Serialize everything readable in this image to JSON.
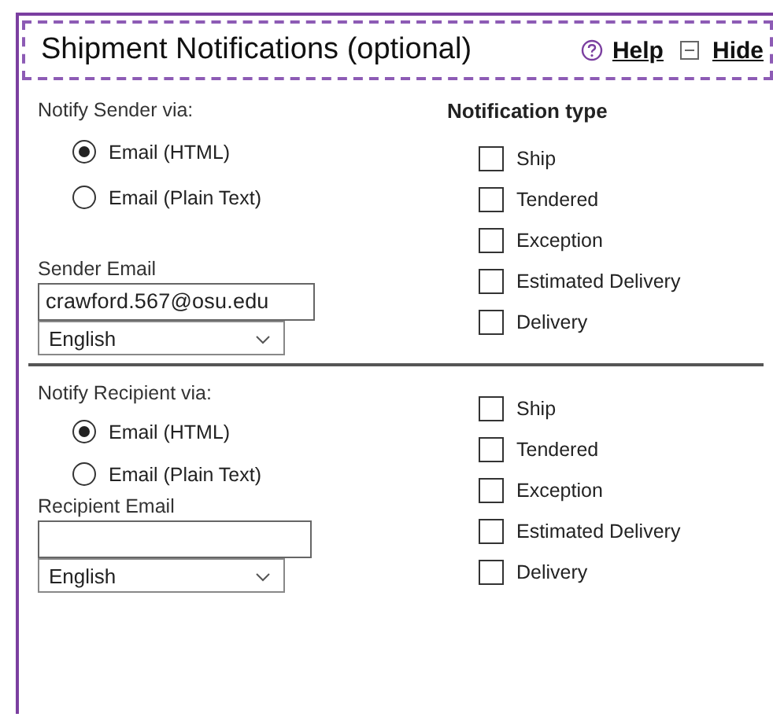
{
  "panel": {
    "title": "Shipment Notifications (optional)",
    "help_link": "Help",
    "hide_link": "Hide"
  },
  "sections": [
    {
      "via_label": "Notify Sender via:",
      "options": [
        {
          "label": "Email (HTML)",
          "selected": true
        },
        {
          "label": "Email (Plain Text)",
          "selected": false
        }
      ],
      "types_heading": "Notification type",
      "types": [
        {
          "label": "Ship",
          "checked": false
        },
        {
          "label": "Tendered",
          "checked": false
        },
        {
          "label": "Exception",
          "checked": false
        },
        {
          "label": "Estimated Delivery",
          "checked": false
        },
        {
          "label": "Delivery",
          "checked": false
        }
      ],
      "email_label": "Sender Email",
      "email_value": "crawford.567@osu.edu",
      "language": "English"
    },
    {
      "via_label": "Notify Recipient via:",
      "options": [
        {
          "label": "Email (HTML)",
          "selected": true
        },
        {
          "label": "Email (Plain Text)",
          "selected": false
        }
      ],
      "types": [
        {
          "label": "Ship",
          "checked": false
        },
        {
          "label": "Tendered",
          "checked": false
        },
        {
          "label": "Exception",
          "checked": false
        },
        {
          "label": "Estimated Delivery",
          "checked": false
        },
        {
          "label": "Delivery",
          "checked": false
        }
      ],
      "email_label": "Recipient Email",
      "language": "English"
    }
  ]
}
